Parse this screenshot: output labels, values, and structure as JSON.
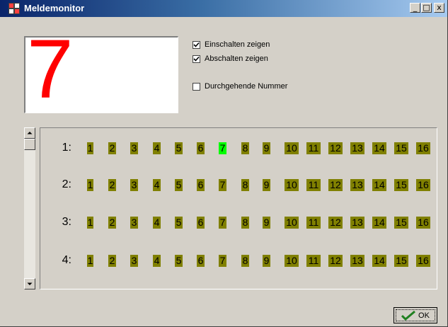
{
  "window": {
    "title": "Meldemonitor",
    "minimize_label": "_",
    "maximize_label": "□",
    "close_label": "x"
  },
  "display": {
    "big_number": "7",
    "color": "#ff0000"
  },
  "options": {
    "show_on": {
      "label": "Einschalten zeigen",
      "checked": true
    },
    "show_off": {
      "label": "Abschalten zeigen",
      "checked": true
    },
    "continuous_number": {
      "label": "Durchgehende Nummer",
      "checked": false
    }
  },
  "monitor": {
    "rows": [
      {
        "label": "1:",
        "cells": [
          "1",
          "2",
          "3",
          "4",
          "5",
          "6",
          "7",
          "8",
          "9",
          "10",
          "11",
          "12",
          "13",
          "14",
          "15",
          "16"
        ],
        "active_index": 6
      },
      {
        "label": "2:",
        "cells": [
          "1",
          "2",
          "3",
          "4",
          "5",
          "6",
          "7",
          "8",
          "9",
          "10",
          "11",
          "12",
          "13",
          "14",
          "15",
          "16"
        ],
        "active_index": -1
      },
      {
        "label": "3:",
        "cells": [
          "1",
          "2",
          "3",
          "4",
          "5",
          "6",
          "7",
          "8",
          "9",
          "10",
          "11",
          "12",
          "13",
          "14",
          "15",
          "16"
        ],
        "active_index": -1
      },
      {
        "label": "4:",
        "cells": [
          "1",
          "2",
          "3",
          "4",
          "5",
          "6",
          "7",
          "8",
          "9",
          "10",
          "11",
          "12",
          "13",
          "14",
          "15",
          "16"
        ],
        "active_index": -1
      }
    ],
    "inactive_color": "#808000",
    "active_color": "#00ff00"
  },
  "footer": {
    "ok_label": "OK"
  }
}
